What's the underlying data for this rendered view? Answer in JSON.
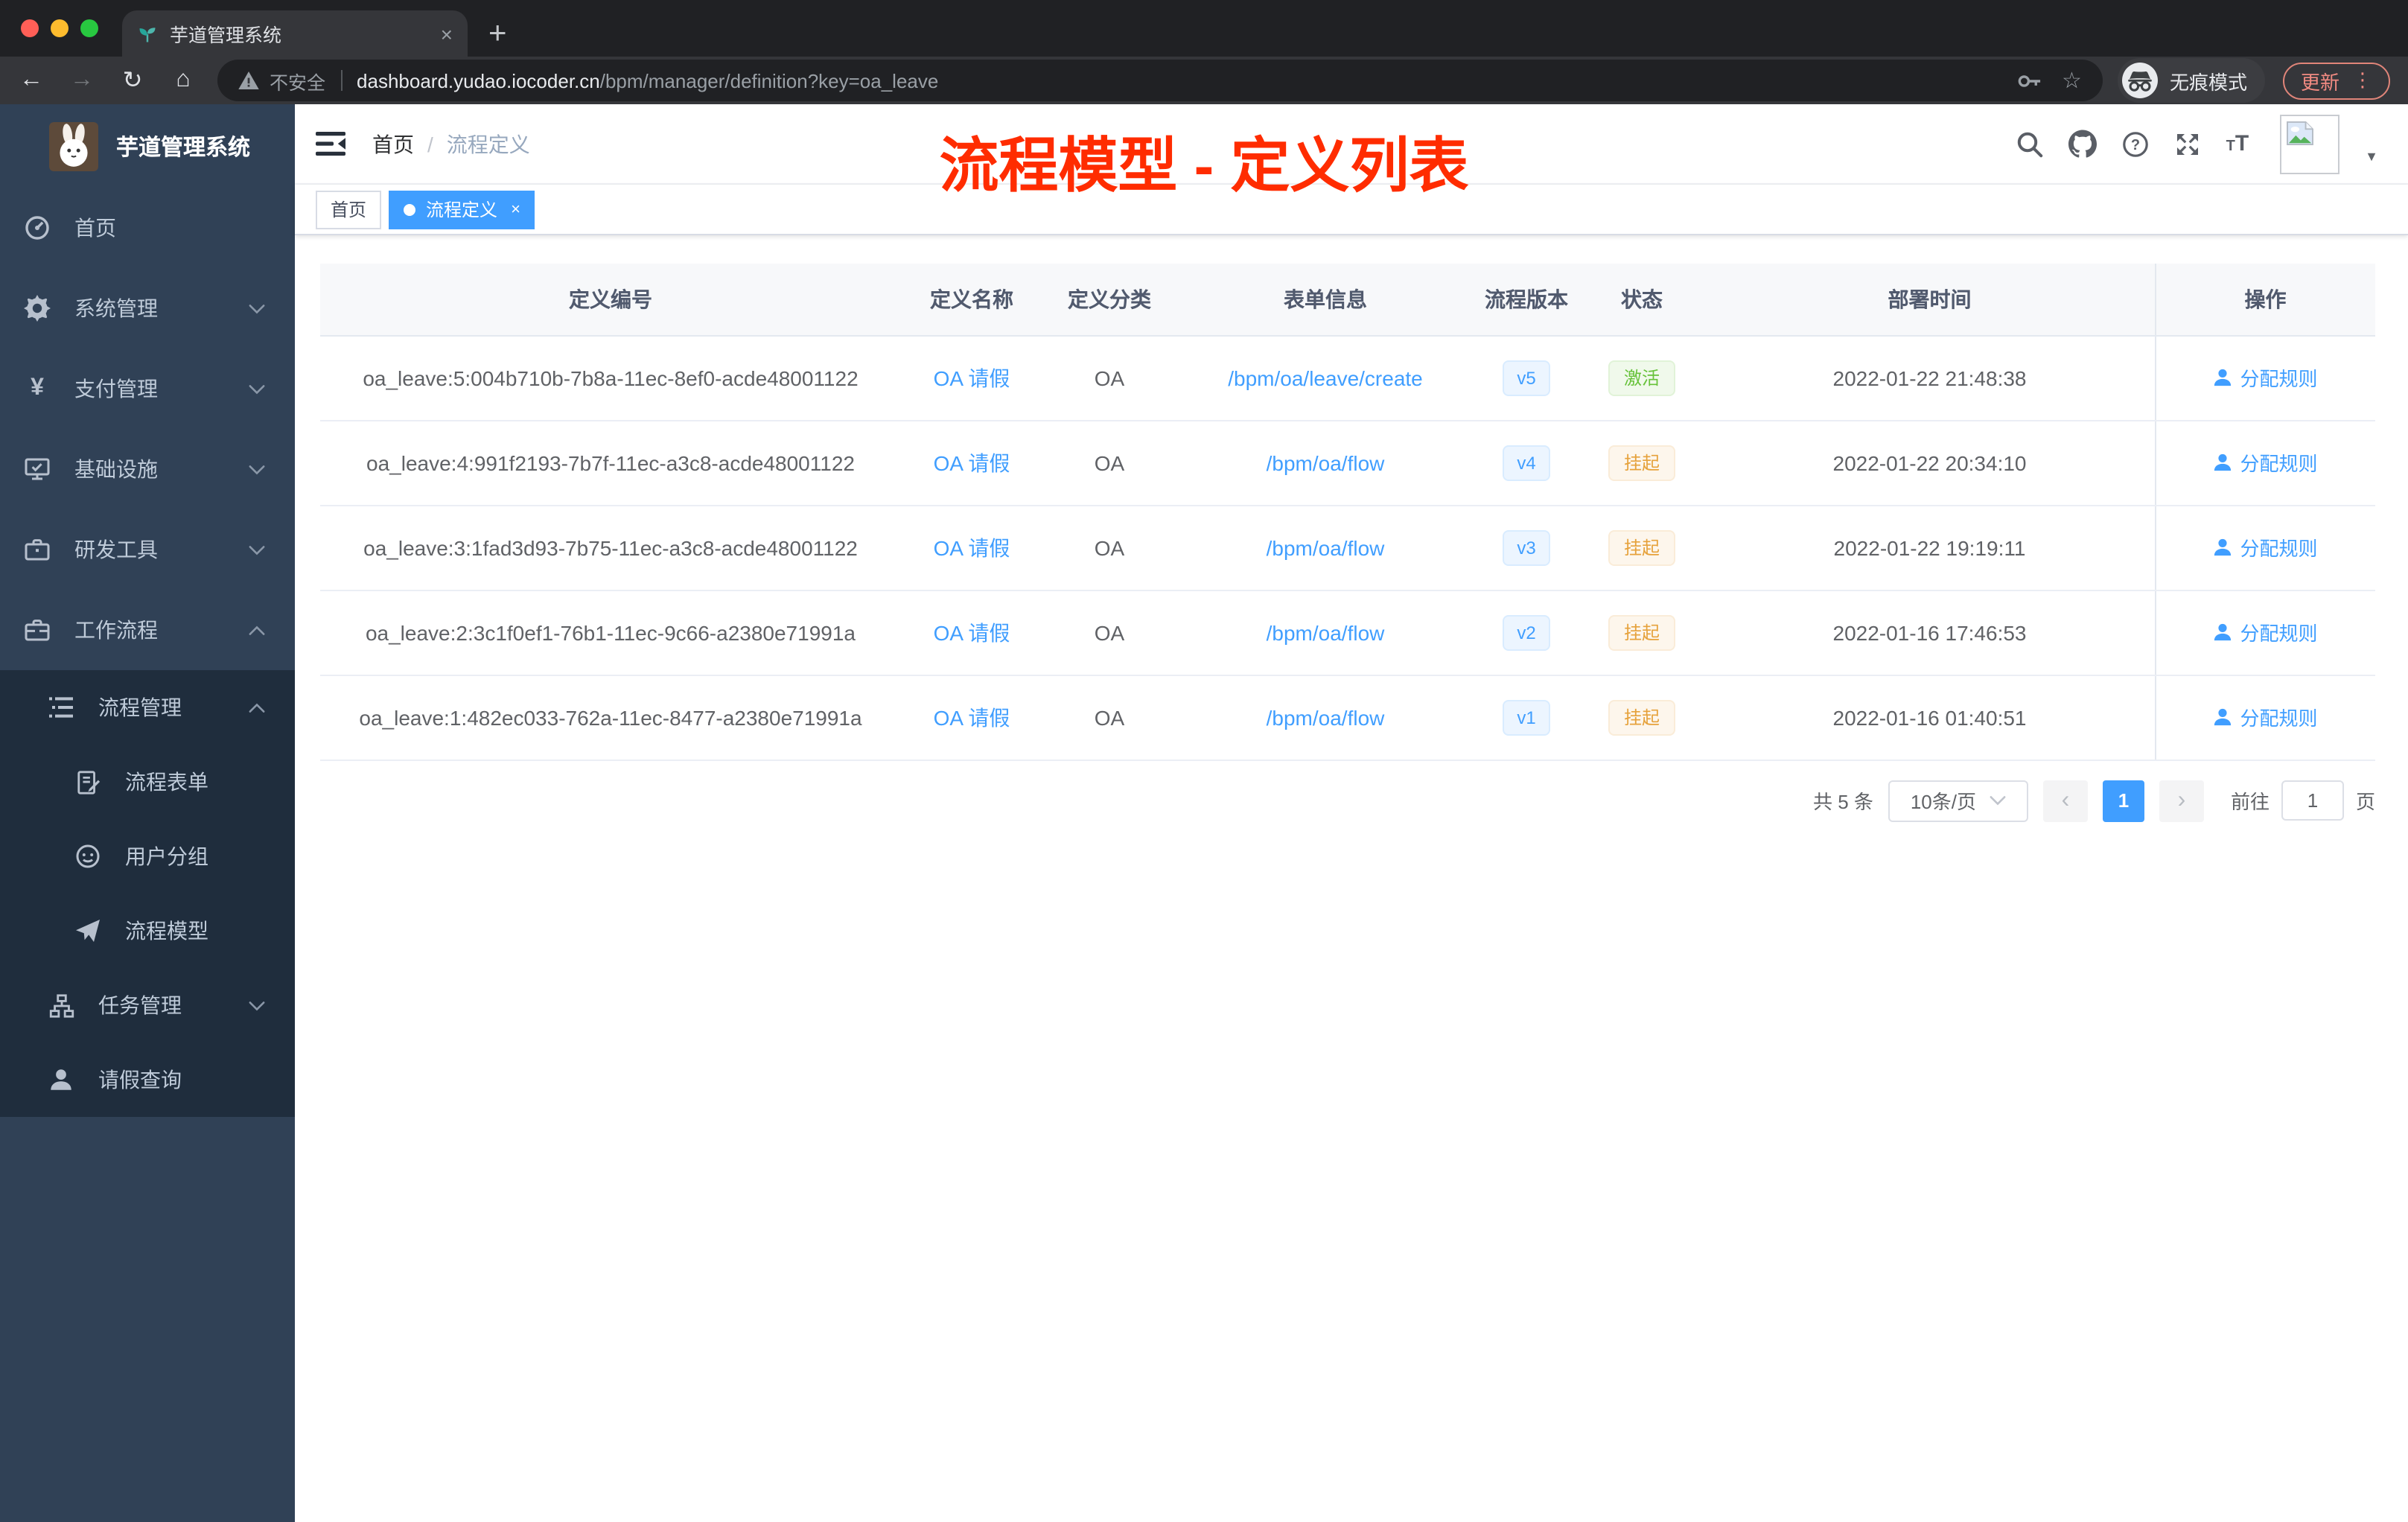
{
  "colors": {
    "accent": "#409EFF",
    "success": "#67C23A",
    "warning": "#E6A23C",
    "annotation": "#FF2C00"
  },
  "browser": {
    "tab_title": "芋道管理系统",
    "close_glyph": "×",
    "new_tab_glyph": "+",
    "back_glyph": "←",
    "forward_glyph": "→",
    "reload_glyph": "↻",
    "home_glyph": "⌂",
    "security_label": "不安全",
    "url_host": "dashboard.yudao.iocoder.cn",
    "url_path": "/bpm/manager/definition?key=oa_leave",
    "star_glyph": "☆",
    "incognito_label": "无痕模式",
    "update_label": "更新",
    "menu_dots_glyph": "⋮",
    "avatar_caret_glyph": "▼"
  },
  "sidebar": {
    "title": "芋道管理系统",
    "items": [
      {
        "label": "首页"
      },
      {
        "label": "系统管理"
      },
      {
        "label": "支付管理"
      },
      {
        "label": "基础设施"
      },
      {
        "label": "研发工具"
      },
      {
        "label": "工作流程"
      }
    ],
    "workflow_children": [
      {
        "label": "流程管理"
      },
      {
        "label": "流程表单"
      },
      {
        "label": "用户分组"
      },
      {
        "label": "流程模型"
      },
      {
        "label": "任务管理"
      },
      {
        "label": "请假查询"
      }
    ]
  },
  "navbar": {
    "breadcrumb_home": "首页",
    "breadcrumb_sep": "/",
    "breadcrumb_current": "流程定义"
  },
  "tags": {
    "home": "首页",
    "current": "流程定义",
    "close_glyph": "×"
  },
  "annotation": "流程模型 - 定义列表",
  "table": {
    "headers": [
      "定义编号",
      "定义名称",
      "定义分类",
      "表单信息",
      "流程版本",
      "状态",
      "部署时间",
      "操作"
    ],
    "action_label": "分配规则",
    "rows": [
      {
        "id": "oa_leave:5:004b710b-7b8a-11ec-8ef0-acde48001122",
        "name": "OA 请假",
        "category": "OA",
        "form": "/bpm/oa/leave/create",
        "version": "v5",
        "status": "激活",
        "time": "2022-01-22 21:48:38"
      },
      {
        "id": "oa_leave:4:991f2193-7b7f-11ec-a3c8-acde48001122",
        "name": "OA 请假",
        "category": "OA",
        "form": "/bpm/oa/flow",
        "version": "v4",
        "status": "挂起",
        "time": "2022-01-22 20:34:10"
      },
      {
        "id": "oa_leave:3:1fad3d93-7b75-11ec-a3c8-acde48001122",
        "name": "OA 请假",
        "category": "OA",
        "form": "/bpm/oa/flow",
        "version": "v3",
        "status": "挂起",
        "time": "2022-01-22 19:19:11"
      },
      {
        "id": "oa_leave:2:3c1f0ef1-76b1-11ec-9c66-a2380e71991a",
        "name": "OA 请假",
        "category": "OA",
        "form": "/bpm/oa/flow",
        "version": "v2",
        "status": "挂起",
        "time": "2022-01-16 17:46:53"
      },
      {
        "id": "oa_leave:1:482ec033-762a-11ec-8477-a2380e71991a",
        "name": "OA 请假",
        "category": "OA",
        "form": "/bpm/oa/flow",
        "version": "v1",
        "status": "挂起",
        "time": "2022-01-16 01:40:51"
      }
    ]
  },
  "pagination": {
    "total": "共 5 条",
    "page_size": "10条/页",
    "prev_glyph": "‹",
    "next_glyph": "›",
    "current_page": "1",
    "goto_label": "前往",
    "goto_value": "1",
    "page_unit": "页"
  }
}
